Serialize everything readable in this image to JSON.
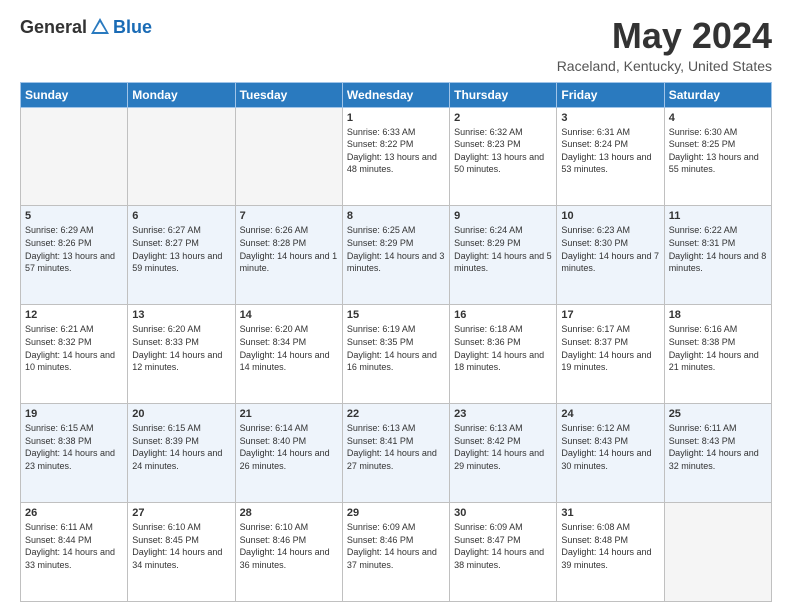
{
  "header": {
    "logo_general": "General",
    "logo_blue": "Blue",
    "month_title": "May 2024",
    "location": "Raceland, Kentucky, United States"
  },
  "weekdays": [
    "Sunday",
    "Monday",
    "Tuesday",
    "Wednesday",
    "Thursday",
    "Friday",
    "Saturday"
  ],
  "weeks": [
    [
      {
        "day": "",
        "sunrise": "",
        "sunset": "",
        "daylight": "",
        "empty": true
      },
      {
        "day": "",
        "sunrise": "",
        "sunset": "",
        "daylight": "",
        "empty": true
      },
      {
        "day": "",
        "sunrise": "",
        "sunset": "",
        "daylight": "",
        "empty": true
      },
      {
        "day": "1",
        "sunrise": "Sunrise: 6:33 AM",
        "sunset": "Sunset: 8:22 PM",
        "daylight": "Daylight: 13 hours and 48 minutes.",
        "empty": false
      },
      {
        "day": "2",
        "sunrise": "Sunrise: 6:32 AM",
        "sunset": "Sunset: 8:23 PM",
        "daylight": "Daylight: 13 hours and 50 minutes.",
        "empty": false
      },
      {
        "day": "3",
        "sunrise": "Sunrise: 6:31 AM",
        "sunset": "Sunset: 8:24 PM",
        "daylight": "Daylight: 13 hours and 53 minutes.",
        "empty": false
      },
      {
        "day": "4",
        "sunrise": "Sunrise: 6:30 AM",
        "sunset": "Sunset: 8:25 PM",
        "daylight": "Daylight: 13 hours and 55 minutes.",
        "empty": false
      }
    ],
    [
      {
        "day": "5",
        "sunrise": "Sunrise: 6:29 AM",
        "sunset": "Sunset: 8:26 PM",
        "daylight": "Daylight: 13 hours and 57 minutes.",
        "empty": false
      },
      {
        "day": "6",
        "sunrise": "Sunrise: 6:27 AM",
        "sunset": "Sunset: 8:27 PM",
        "daylight": "Daylight: 13 hours and 59 minutes.",
        "empty": false
      },
      {
        "day": "7",
        "sunrise": "Sunrise: 6:26 AM",
        "sunset": "Sunset: 8:28 PM",
        "daylight": "Daylight: 14 hours and 1 minute.",
        "empty": false
      },
      {
        "day": "8",
        "sunrise": "Sunrise: 6:25 AM",
        "sunset": "Sunset: 8:29 PM",
        "daylight": "Daylight: 14 hours and 3 minutes.",
        "empty": false
      },
      {
        "day": "9",
        "sunrise": "Sunrise: 6:24 AM",
        "sunset": "Sunset: 8:29 PM",
        "daylight": "Daylight: 14 hours and 5 minutes.",
        "empty": false
      },
      {
        "day": "10",
        "sunrise": "Sunrise: 6:23 AM",
        "sunset": "Sunset: 8:30 PM",
        "daylight": "Daylight: 14 hours and 7 minutes.",
        "empty": false
      },
      {
        "day": "11",
        "sunrise": "Sunrise: 6:22 AM",
        "sunset": "Sunset: 8:31 PM",
        "daylight": "Daylight: 14 hours and 8 minutes.",
        "empty": false
      }
    ],
    [
      {
        "day": "12",
        "sunrise": "Sunrise: 6:21 AM",
        "sunset": "Sunset: 8:32 PM",
        "daylight": "Daylight: 14 hours and 10 minutes.",
        "empty": false
      },
      {
        "day": "13",
        "sunrise": "Sunrise: 6:20 AM",
        "sunset": "Sunset: 8:33 PM",
        "daylight": "Daylight: 14 hours and 12 minutes.",
        "empty": false
      },
      {
        "day": "14",
        "sunrise": "Sunrise: 6:20 AM",
        "sunset": "Sunset: 8:34 PM",
        "daylight": "Daylight: 14 hours and 14 minutes.",
        "empty": false
      },
      {
        "day": "15",
        "sunrise": "Sunrise: 6:19 AM",
        "sunset": "Sunset: 8:35 PM",
        "daylight": "Daylight: 14 hours and 16 minutes.",
        "empty": false
      },
      {
        "day": "16",
        "sunrise": "Sunrise: 6:18 AM",
        "sunset": "Sunset: 8:36 PM",
        "daylight": "Daylight: 14 hours and 18 minutes.",
        "empty": false
      },
      {
        "day": "17",
        "sunrise": "Sunrise: 6:17 AM",
        "sunset": "Sunset: 8:37 PM",
        "daylight": "Daylight: 14 hours and 19 minutes.",
        "empty": false
      },
      {
        "day": "18",
        "sunrise": "Sunrise: 6:16 AM",
        "sunset": "Sunset: 8:38 PM",
        "daylight": "Daylight: 14 hours and 21 minutes.",
        "empty": false
      }
    ],
    [
      {
        "day": "19",
        "sunrise": "Sunrise: 6:15 AM",
        "sunset": "Sunset: 8:38 PM",
        "daylight": "Daylight: 14 hours and 23 minutes.",
        "empty": false
      },
      {
        "day": "20",
        "sunrise": "Sunrise: 6:15 AM",
        "sunset": "Sunset: 8:39 PM",
        "daylight": "Daylight: 14 hours and 24 minutes.",
        "empty": false
      },
      {
        "day": "21",
        "sunrise": "Sunrise: 6:14 AM",
        "sunset": "Sunset: 8:40 PM",
        "daylight": "Daylight: 14 hours and 26 minutes.",
        "empty": false
      },
      {
        "day": "22",
        "sunrise": "Sunrise: 6:13 AM",
        "sunset": "Sunset: 8:41 PM",
        "daylight": "Daylight: 14 hours and 27 minutes.",
        "empty": false
      },
      {
        "day": "23",
        "sunrise": "Sunrise: 6:13 AM",
        "sunset": "Sunset: 8:42 PM",
        "daylight": "Daylight: 14 hours and 29 minutes.",
        "empty": false
      },
      {
        "day": "24",
        "sunrise": "Sunrise: 6:12 AM",
        "sunset": "Sunset: 8:43 PM",
        "daylight": "Daylight: 14 hours and 30 minutes.",
        "empty": false
      },
      {
        "day": "25",
        "sunrise": "Sunrise: 6:11 AM",
        "sunset": "Sunset: 8:43 PM",
        "daylight": "Daylight: 14 hours and 32 minutes.",
        "empty": false
      }
    ],
    [
      {
        "day": "26",
        "sunrise": "Sunrise: 6:11 AM",
        "sunset": "Sunset: 8:44 PM",
        "daylight": "Daylight: 14 hours and 33 minutes.",
        "empty": false
      },
      {
        "day": "27",
        "sunrise": "Sunrise: 6:10 AM",
        "sunset": "Sunset: 8:45 PM",
        "daylight": "Daylight: 14 hours and 34 minutes.",
        "empty": false
      },
      {
        "day": "28",
        "sunrise": "Sunrise: 6:10 AM",
        "sunset": "Sunset: 8:46 PM",
        "daylight": "Daylight: 14 hours and 36 minutes.",
        "empty": false
      },
      {
        "day": "29",
        "sunrise": "Sunrise: 6:09 AM",
        "sunset": "Sunset: 8:46 PM",
        "daylight": "Daylight: 14 hours and 37 minutes.",
        "empty": false
      },
      {
        "day": "30",
        "sunrise": "Sunrise: 6:09 AM",
        "sunset": "Sunset: 8:47 PM",
        "daylight": "Daylight: 14 hours and 38 minutes.",
        "empty": false
      },
      {
        "day": "31",
        "sunrise": "Sunrise: 6:08 AM",
        "sunset": "Sunset: 8:48 PM",
        "daylight": "Daylight: 14 hours and 39 minutes.",
        "empty": false
      },
      {
        "day": "",
        "sunrise": "",
        "sunset": "",
        "daylight": "",
        "empty": true
      }
    ]
  ]
}
